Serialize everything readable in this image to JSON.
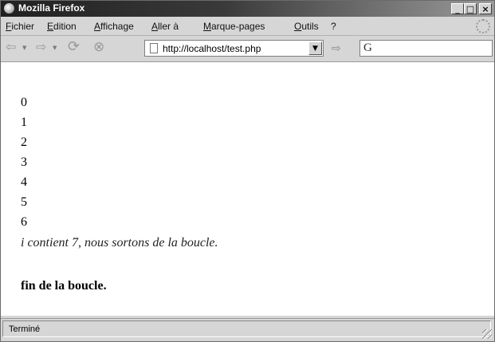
{
  "window": {
    "title": "Mozilla Firefox",
    "min": "_",
    "max": "□",
    "close": "×"
  },
  "menu": [
    "Fichier",
    "Edition",
    "Affichage",
    "Aller à",
    "Marque-pages",
    "Outils",
    "?"
  ],
  "navbar": {
    "url": "http://localhost/test.php",
    "search_engine": "G"
  },
  "content": {
    "lines": [
      "0",
      "1",
      "2",
      "3",
      "4",
      "5",
      "6"
    ],
    "italic_message": "i contient 7, nous sortons de la boucle.",
    "bold_message": "fin de la boucle."
  },
  "status": {
    "text": "Terminé"
  }
}
